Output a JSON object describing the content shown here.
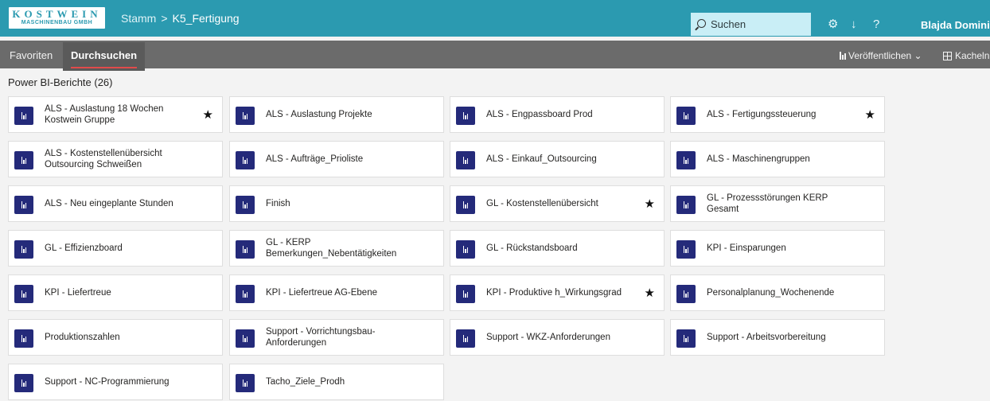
{
  "header": {
    "logo_line1": "KOSTWEIN",
    "logo_line2": "MASCHINENBAU GMBH",
    "breadcrumb_root": "Stamm",
    "breadcrumb_sep": ">",
    "breadcrumb_current": "K5_Fertigung",
    "search_label": "Suchen",
    "settings_icon": "⚙",
    "download_icon": "↓",
    "help_icon": "?",
    "user_name": "Blajda Dominik"
  },
  "nav": {
    "tabs": [
      {
        "label": "Favoriten",
        "active": false
      },
      {
        "label": "Durchsuchen",
        "active": true
      }
    ],
    "publish_label": "Veröffentlichen ⌄",
    "tiles_label": "Kacheln"
  },
  "section": {
    "title": "Power BI-Berichte (26)"
  },
  "reports": [
    {
      "title": "ALS - Auslastung 18 Wochen Kostwein Gruppe",
      "favorite": true
    },
    {
      "title": "ALS - Auslastung Projekte",
      "favorite": false
    },
    {
      "title": "ALS - Engpassboard Prod",
      "favorite": false
    },
    {
      "title": "ALS - Fertigungssteuerung",
      "favorite": true
    },
    {
      "title": "ALS - Kostenstellenübersicht Outsourcing Schweißen",
      "favorite": false
    },
    {
      "title": "ALS - Aufträge_Prioliste",
      "favorite": false
    },
    {
      "title": "ALS - Einkauf_Outsourcing",
      "favorite": false
    },
    {
      "title": "ALS - Maschinengruppen",
      "favorite": false
    },
    {
      "title": "ALS - Neu eingeplante Stunden",
      "favorite": false
    },
    {
      "title": "Finish",
      "favorite": false
    },
    {
      "title": "GL - Kostenstellenübersicht",
      "favorite": true
    },
    {
      "title": "GL - Prozessstörungen KERP Gesamt",
      "favorite": false
    },
    {
      "title": "GL - Effizienzboard",
      "favorite": false
    },
    {
      "title": "GL - KERP Bemerkungen_Nebentätigkeiten",
      "favorite": false
    },
    {
      "title": "GL - Rückstandsboard",
      "favorite": false
    },
    {
      "title": "KPI - Einsparungen",
      "favorite": false
    },
    {
      "title": "KPI - Liefertreue",
      "favorite": false
    },
    {
      "title": "KPI - Liefertreue AG-Ebene",
      "favorite": false
    },
    {
      "title": "KPI - Produktive h_Wirkungsgrad",
      "favorite": true
    },
    {
      "title": "Personalplanung_Wochenende",
      "favorite": false
    },
    {
      "title": "Produktionszahlen",
      "favorite": false
    },
    {
      "title": "Support - Vorrichtungsbau-Anforderungen",
      "favorite": false
    },
    {
      "title": "Support - WKZ-Anforderungen",
      "favorite": false
    },
    {
      "title": "Support - Arbeitsvorbereitung",
      "favorite": false
    },
    {
      "title": "Support - NC-Programmierung",
      "favorite": false
    },
    {
      "title": "Tacho_Ziele_Prodh",
      "favorite": false
    }
  ],
  "icons": {
    "report": "power-bi-report-icon",
    "favorite": "star-icon"
  },
  "colors": {
    "header": "#2b9ab0",
    "nav": "#6b6b6b",
    "report_icon": "#242a7a",
    "active_underline": "#e04a4a"
  },
  "star_glyph": "★"
}
